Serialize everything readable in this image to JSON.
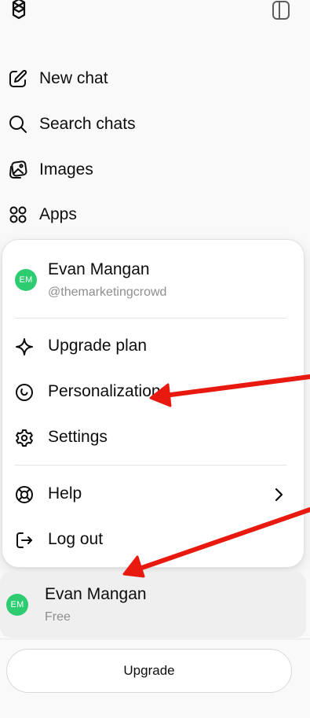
{
  "nav": {
    "items": [
      {
        "label": "New chat",
        "icon": "edit-icon"
      },
      {
        "label": "Search chats",
        "icon": "search-icon"
      },
      {
        "label": "Images",
        "icon": "images-icon"
      },
      {
        "label": "Apps",
        "icon": "apps-icon"
      }
    ]
  },
  "menu": {
    "user": {
      "initials": "EM",
      "name": "Evan Mangan",
      "handle": "@themarketingcrowd"
    },
    "items": [
      {
        "label": "Upgrade plan",
        "icon": "sparkle-icon"
      },
      {
        "label": "Personalization",
        "icon": "personalization-icon"
      },
      {
        "label": "Settings",
        "icon": "gear-icon"
      },
      {
        "label": "Help",
        "icon": "lifebuoy-icon",
        "has_submenu": true
      },
      {
        "label": "Log out",
        "icon": "logout-icon"
      }
    ]
  },
  "profile": {
    "initials": "EM",
    "name": "Evan Mangan",
    "plan": "Free"
  },
  "upgrade": {
    "label": "Upgrade"
  },
  "colors": {
    "avatar": "#2ecc71",
    "annotation_arrow": "#e8190f",
    "sidebar_background": "#f9f9f9"
  }
}
